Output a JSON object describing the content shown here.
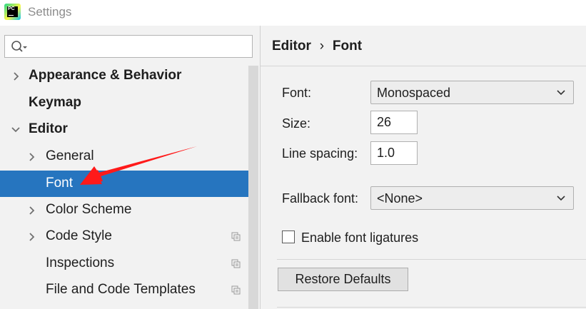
{
  "window": {
    "title": "Settings",
    "app_icon_text": "PC"
  },
  "search": {
    "placeholder": "",
    "value": ""
  },
  "sidebar": {
    "items": [
      {
        "label": "Appearance & Behavior",
        "bold": true,
        "expandable": true,
        "expanded": false
      },
      {
        "label": "Keymap",
        "bold": true,
        "expandable": false
      },
      {
        "label": "Editor",
        "bold": true,
        "expandable": true,
        "expanded": true
      },
      {
        "label": "General",
        "bold": false,
        "expandable": true,
        "expanded": false
      },
      {
        "label": "Font",
        "bold": false,
        "expandable": false,
        "selected": true
      },
      {
        "label": "Color Scheme",
        "bold": false,
        "expandable": true,
        "expanded": false
      },
      {
        "label": "Code Style",
        "bold": false,
        "expandable": true,
        "expanded": false,
        "icon": "copy-icon"
      },
      {
        "label": "Inspections",
        "bold": false,
        "expandable": false,
        "icon": "copy-icon"
      },
      {
        "label": "File and Code Templates",
        "bold": false,
        "expandable": false,
        "icon": "copy-icon"
      }
    ]
  },
  "breadcrumb": {
    "parent": "Editor",
    "separator": "›",
    "current": "Font"
  },
  "form": {
    "font": {
      "label": "Font:",
      "value": "Monospaced"
    },
    "size": {
      "label": "Size:",
      "value": "26"
    },
    "line_spacing": {
      "label": "Line spacing:",
      "value": "1.0"
    },
    "fallback_font": {
      "label": "Fallback font:",
      "value": "<None>"
    },
    "ligatures": {
      "label": "Enable font ligatures",
      "checked": false
    }
  },
  "buttons": {
    "restore_defaults": "Restore Defaults"
  },
  "colors": {
    "selection": "#2675bf",
    "annotation_arrow": "#ff1a1a"
  }
}
